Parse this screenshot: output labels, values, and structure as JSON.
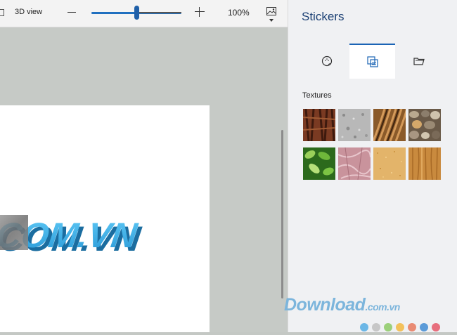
{
  "toolbar": {
    "view_label": "3D view",
    "zoom_label": "100%",
    "zoom_percent": 53
  },
  "canvas": {
    "text": "COM.VN"
  },
  "panel": {
    "title": "Stickers",
    "tabs": [
      {
        "icon": "sticker-icon",
        "active": false
      },
      {
        "icon": "texture-icon",
        "active": true
      },
      {
        "icon": "folder-icon",
        "active": false
      }
    ],
    "section_label": "Textures",
    "textures": [
      "bark",
      "granite",
      "hair",
      "pebbles",
      "leaves",
      "pink-marble",
      "sand",
      "wood"
    ]
  },
  "watermark": {
    "text": "Download",
    "suffix": ".com.vn",
    "dots": [
      "#6cb7e6",
      "#c7c7c7",
      "#9cd07a",
      "#f3c15b",
      "#e98b73",
      "#5b9bd8",
      "#e76f7d"
    ]
  }
}
